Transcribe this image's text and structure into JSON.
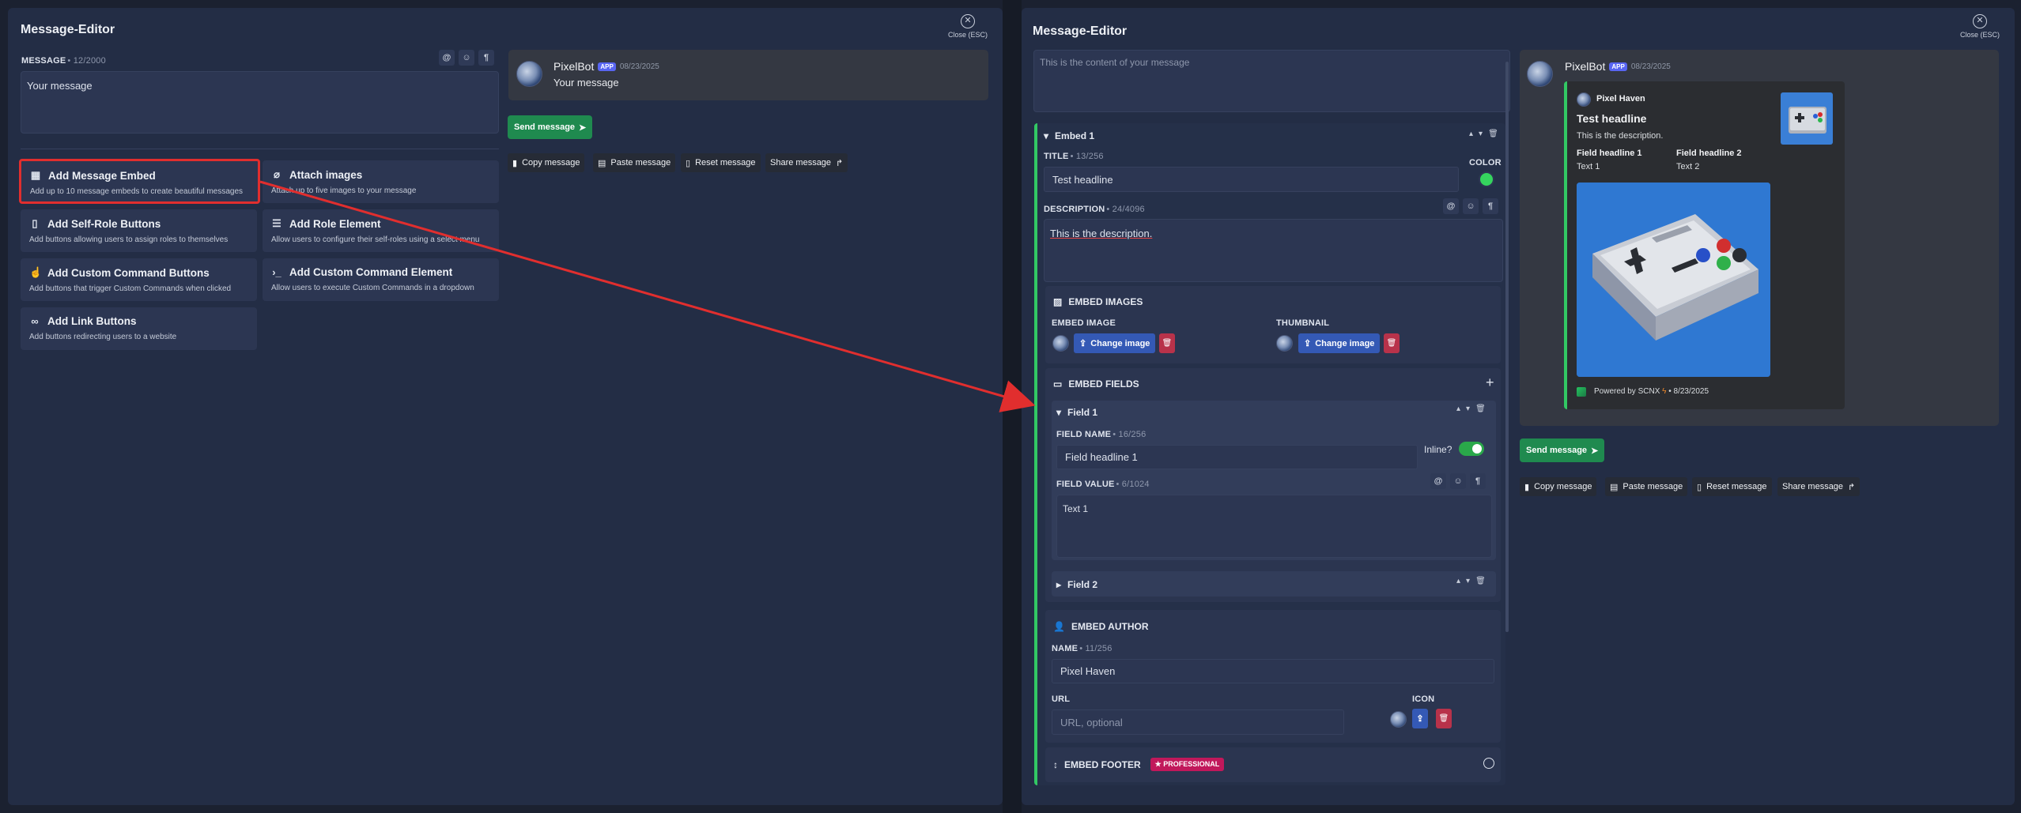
{
  "colors": {
    "panel": "#232d45",
    "accent_green": "#32c864",
    "send_button": "#1f8a4f",
    "selection": "#e12e2e",
    "arrow": "#e12e2e",
    "change_image": "#3459b5",
    "delete": "#b8324a",
    "professional_badge": "#c1185b"
  },
  "left": {
    "title": "Message-Editor",
    "close": "Close (ESC)",
    "message_label": "MESSAGE",
    "message_count": "• 12/2000",
    "message_value": "Your message",
    "actions": [
      {
        "title": "Add Message Embed",
        "desc": "Add up to 10 message embeds to create beautiful messages",
        "icon": "table-icon"
      },
      {
        "title": "Attach images",
        "desc": "Attach up to five images to your message",
        "icon": "paperclip-icon"
      },
      {
        "title": "Add Self-Role Buttons",
        "desc": "Add buttons allowing users to assign roles to themselves",
        "icon": "button-icon"
      },
      {
        "title": "Add Role Element",
        "desc": "Allow users to configure their self-roles using a select menu",
        "icon": "list-icon"
      },
      {
        "title": "Add Custom Command Buttons",
        "desc": "Add buttons that trigger Custom Commands when clicked",
        "icon": "pointer-icon"
      },
      {
        "title": "Add Custom Command Element",
        "desc": "Allow users to execute Custom Commands in a dropdown",
        "icon": "terminal-icon"
      },
      {
        "title": "Add Link Buttons",
        "desc": "Add buttons redirecting users to a website",
        "icon": "link-icon"
      }
    ],
    "preview": {
      "bot": "PixelBot",
      "badge": "APP",
      "date": "08/23/2025",
      "text": "Your message"
    },
    "send": "Send message",
    "buttons": [
      "Copy message",
      "Paste message",
      "Reset message",
      "Share message"
    ]
  },
  "right": {
    "title": "Message-Editor",
    "close": "Close (ESC)",
    "message_placeholder": "This is the content of your message",
    "embed_label": "Embed 1",
    "title_label": "TITLE",
    "title_count": "• 13/256",
    "title_value": "Test headline",
    "color_label": "COLOR",
    "desc_label": "DESCRIPTION",
    "desc_count": "• 24/4096",
    "desc_value": "This is the description.",
    "images_label": "EMBED IMAGES",
    "embed_image_label": "EMBED IMAGE",
    "thumbnail_label": "THUMBNAIL",
    "change_image": "Change image",
    "fields_label": "EMBED FIELDS",
    "field1": "Field 1",
    "field_name_label": "FIELD NAME",
    "field_name_count": "• 16/256",
    "field_name_value": "Field headline 1",
    "inline_label": "Inline?",
    "field_value_label": "FIELD VALUE",
    "field_value_count": "• 6/1024",
    "field_value_value": "Text 1",
    "field2": "Field 2",
    "author_label": "EMBED AUTHOR",
    "author_name_label": "NAME",
    "author_name_count": "• 11/256",
    "author_name_value": "Pixel Haven",
    "url_label": "URL",
    "url_placeholder": "URL, optional",
    "icon_label": "ICON",
    "footer_label": "EMBED FOOTER",
    "professional": "PROFESSIONAL",
    "preview": {
      "bot": "PixelBot",
      "badge": "APP",
      "date": "08/23/2025",
      "author": "Pixel Haven",
      "title": "Test headline",
      "desc": "This is the description.",
      "fields": [
        {
          "name": "Field headline 1",
          "value": "Text 1"
        },
        {
          "name": "Field headline 2",
          "value": "Text 2"
        }
      ],
      "footer": "Powered by SCNX",
      "footer_date": "• 8/23/2025"
    },
    "send": "Send message",
    "buttons": [
      "Copy message",
      "Paste message",
      "Reset message",
      "Share message"
    ]
  }
}
